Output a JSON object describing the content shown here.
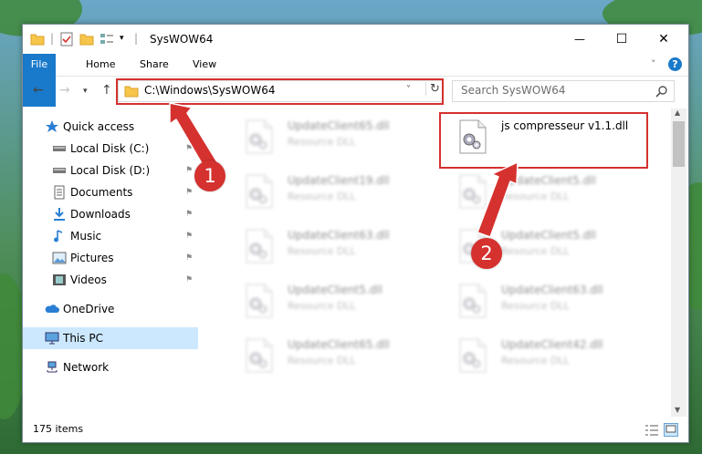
{
  "window": {
    "title": "SysWOW64",
    "minimize_icon": "—",
    "maximize_icon": "☐",
    "close_icon": "✕"
  },
  "ribbon": {
    "tabs": [
      "File",
      "Home",
      "Share",
      "View"
    ],
    "expand_icon": "˅",
    "help_icon": "?"
  },
  "address": {
    "path": "C:\\Windows\\SysWOW64",
    "search_placeholder": "Search SysWOW64"
  },
  "sidebar": {
    "items": [
      {
        "label": "Quick access",
        "icon": "star-icon",
        "pinned": false
      },
      {
        "label": "Local Disk (C:)",
        "icon": "drive-icon",
        "pinned": true
      },
      {
        "label": "Local Disk (D:)",
        "icon": "drive-icon",
        "pinned": true
      },
      {
        "label": "Documents",
        "icon": "documents-icon",
        "pinned": true
      },
      {
        "label": "Downloads",
        "icon": "downloads-icon",
        "pinned": true
      },
      {
        "label": "Music",
        "icon": "music-icon",
        "pinned": true
      },
      {
        "label": "Pictures",
        "icon": "pictures-icon",
        "pinned": true
      },
      {
        "label": "Videos",
        "icon": "videos-icon",
        "pinned": true
      },
      {
        "label": "OneDrive",
        "icon": "onedrive-icon",
        "pinned": false
      },
      {
        "label": "This PC",
        "icon": "this-pc-icon",
        "pinned": false
      },
      {
        "label": "Network",
        "icon": "network-icon",
        "pinned": false
      }
    ]
  },
  "files": [
    {
      "name": "UpdateClient65.dll",
      "type": "Resource DLL",
      "highlighted": false
    },
    {
      "name": "js compresseur v1.1.dll",
      "type": "",
      "highlighted": true
    },
    {
      "name": "UpdateClient19.dll",
      "type": "Resource DLL",
      "highlighted": false
    },
    {
      "name": "UpdateClient5.dll",
      "type": "Resource DLL",
      "highlighted": false
    },
    {
      "name": "UpdateClient63.dll",
      "type": "Resource DLL",
      "highlighted": false
    },
    {
      "name": "UpdateClient5.dll",
      "type": "Resource DLL",
      "highlighted": false
    },
    {
      "name": "UpdateClient5.dll",
      "type": "Resource DLL",
      "highlighted": false
    },
    {
      "name": "UpdateClient63.dll",
      "type": "Resource DLL",
      "highlighted": false
    },
    {
      "name": "UpdateClient65.dll",
      "type": "Resource DLL",
      "highlighted": false
    },
    {
      "name": "UpdateClient42.dll",
      "type": "Resource DLL",
      "highlighted": false
    }
  ],
  "status": {
    "item_count": "175 items"
  },
  "annotations": {
    "step1": "1",
    "step2": "2",
    "color": "#d5312e"
  }
}
